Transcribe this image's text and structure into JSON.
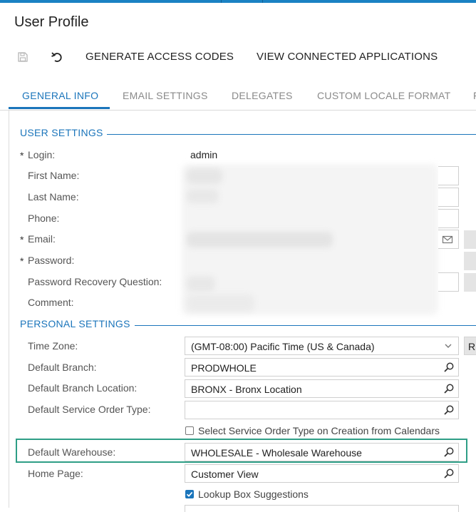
{
  "page": {
    "title": "User Profile"
  },
  "toolbar": {
    "save_icon": "save-icon",
    "undo_icon": "undo-icon",
    "generate_access_codes": "GENERATE ACCESS CODES",
    "view_connected_applications": "VIEW CONNECTED APPLICATIONS"
  },
  "tabs": [
    {
      "label": "GENERAL INFO",
      "active": true
    },
    {
      "label": "EMAIL SETTINGS",
      "active": false
    },
    {
      "label": "DELEGATES",
      "active": false
    },
    {
      "label": "CUSTOM LOCALE FORMAT",
      "active": false
    },
    {
      "label": "F",
      "active": false
    }
  ],
  "user_settings": {
    "title": "USER SETTINGS",
    "required_marker": "*",
    "login": {
      "label": "Login:",
      "value": "admin"
    },
    "first_name": {
      "label": "First Name:"
    },
    "last_name": {
      "label": "Last Name:"
    },
    "phone": {
      "label": "Phone:"
    },
    "email": {
      "label": "Email:",
      "icon": "mail-icon"
    },
    "password": {
      "label": "Password:"
    },
    "password_recovery_question": {
      "label": "Password Recovery Question:"
    },
    "comment": {
      "label": "Comment:"
    }
  },
  "personal_settings": {
    "title": "PERSONAL SETTINGS",
    "time_zone": {
      "label": "Time Zone:",
      "value": "(GMT-08:00) Pacific Time (US & Canada)",
      "side_button": "R"
    },
    "default_branch": {
      "label": "Default Branch:",
      "value": "PRODWHOLE"
    },
    "default_branch_location": {
      "label": "Default Branch Location:",
      "value": "BRONX - Bronx Location"
    },
    "default_service_order_type": {
      "label": "Default Service Order Type:",
      "value": ""
    },
    "select_service_order_type": {
      "label": "Select Service Order Type on Creation from Calendars",
      "checked": false
    },
    "default_warehouse": {
      "label": "Default Warehouse:",
      "value": "WHOLESALE - Wholesale Warehouse"
    },
    "home_page": {
      "label": "Home Page:",
      "value": "Customer View"
    },
    "lookup_box_suggestions": {
      "label": "Lookup Box Suggestions",
      "checked": true
    }
  },
  "colors": {
    "accent": "#1b75bb",
    "highlight": "#2e9e86",
    "top_strip": "#1a82c3"
  }
}
